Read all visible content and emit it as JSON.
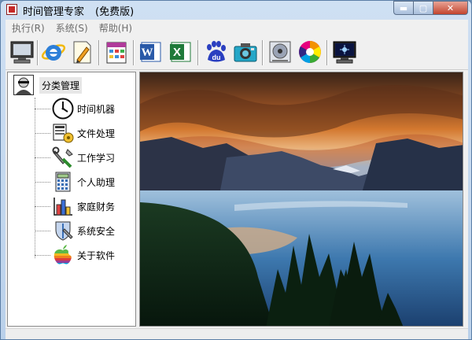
{
  "window": {
    "title": "时间管理专家",
    "edition": "(免费版)",
    "min_symbol": "▬",
    "max_symbol": "▢",
    "close_symbol": "✕"
  },
  "menu": [
    {
      "label": "执行(R)"
    },
    {
      "label": "系统(S)"
    },
    {
      "label": "帮助(H)"
    }
  ],
  "toolbar": {
    "buttons": [
      {
        "icon": "monitor-icon"
      },
      {
        "icon": "internet-explorer-icon"
      },
      {
        "icon": "notepad-icon"
      },
      {
        "icon": "calendar-icon"
      },
      {
        "icon": "word-icon",
        "glyph": "W"
      },
      {
        "icon": "excel-icon",
        "glyph": "X"
      },
      {
        "icon": "baidu-icon",
        "glyph": "du"
      },
      {
        "icon": "camera-icon"
      },
      {
        "icon": "media-player-icon"
      },
      {
        "icon": "color-wheel-icon"
      },
      {
        "icon": "screensaver-icon"
      }
    ]
  },
  "tree": {
    "root": {
      "label": "分类管理",
      "icon": "user-avatar-icon"
    },
    "items": [
      {
        "label": "时间机器",
        "icon": "clock-icon"
      },
      {
        "label": "文件处理",
        "icon": "file-processing-icon"
      },
      {
        "label": "工作学习",
        "icon": "tools-icon"
      },
      {
        "label": "个人助理",
        "icon": "calculator-icon"
      },
      {
        "label": "家庭财务",
        "icon": "bar-chart-icon"
      },
      {
        "label": "系统安全",
        "icon": "shield-icon"
      },
      {
        "label": "关于软件",
        "icon": "apple-logo-icon"
      }
    ]
  },
  "preview": {
    "image": "mountain-lake-landscape"
  },
  "colors": {
    "title_bar": "#b9d0ea",
    "menu_text_disabled": "#6d6d6d",
    "close_button": "#c3452e"
  }
}
